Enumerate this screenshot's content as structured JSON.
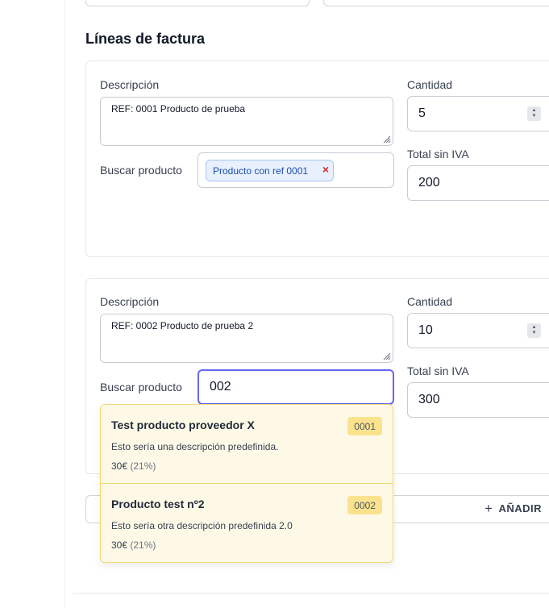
{
  "section": {
    "title": "Líneas de factura"
  },
  "labels": {
    "description": "Descripción",
    "quantity": "Cantidad",
    "search_product": "Buscar producto",
    "total": "Total sin IVA"
  },
  "lines": [
    {
      "description": "REF: 0001 Producto de prueba",
      "quantity": "5",
      "total": "200",
      "selected_product": "Producto con ref 0001",
      "remove_symbol": "×"
    },
    {
      "description": "REF: 0002 Producto de prueba 2",
      "quantity": "10",
      "total": "300",
      "search_query": "002"
    }
  ],
  "dropdown": {
    "options": [
      {
        "title": "Test producto proveedor X",
        "ref": "0001",
        "description": "Esto sería una descripción predefinida.",
        "price": "30€",
        "tax": "(21%)"
      },
      {
        "title": "Producto test nº2",
        "ref": "0002",
        "description": "Esto sería otra descripción predefinida 2.0",
        "price": "30€",
        "tax": "(21%)"
      }
    ]
  },
  "add_button": {
    "label": "AÑADIR",
    "icon": "plus-icon"
  },
  "colors": {
    "focus": "#6366f1",
    "dropdown_bg": "#fef9e7",
    "badge_bg": "#fbe38e",
    "chip_bg": "#e8f0fe",
    "remove": "#dc2626"
  }
}
